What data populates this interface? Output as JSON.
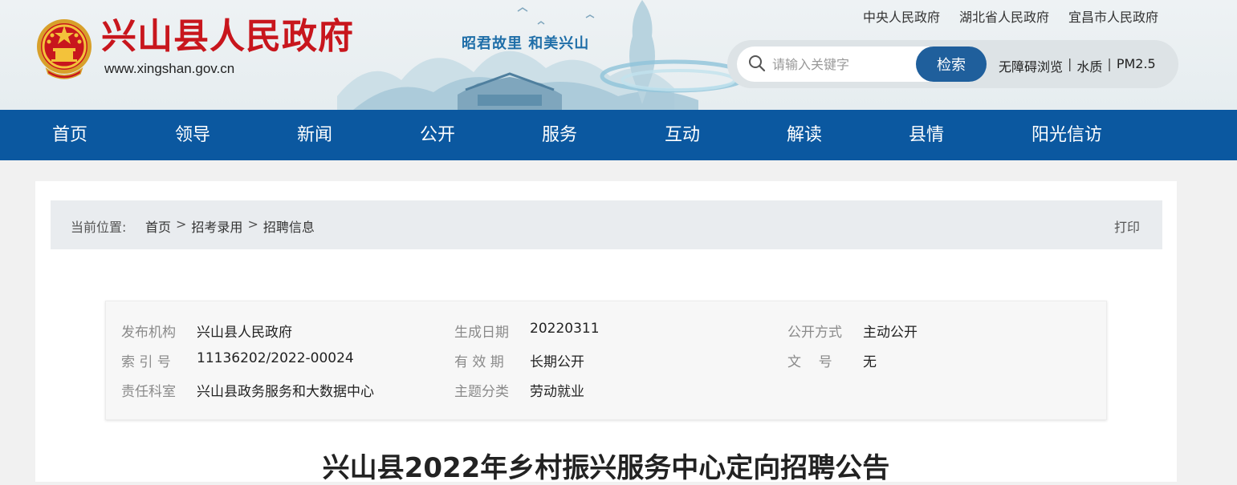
{
  "header": {
    "site_title": "兴山县人民政府",
    "site_url": "www.xingshan.gov.cn",
    "slogan": "昭君故里  和美兴山",
    "top_links": [
      "中央人民政府",
      "湖北省人民政府",
      "宜昌市人民政府"
    ],
    "search": {
      "placeholder": "请输入关键字",
      "button": "检索"
    },
    "tools": [
      "无障碍浏览",
      "水质",
      "PM2.5"
    ],
    "brand_color": "#c8161d",
    "accent_color": "#0b58a0"
  },
  "nav": {
    "items": [
      "首页",
      "领导",
      "新闻",
      "公开",
      "服务",
      "互动",
      "解读",
      "县情",
      "阳光信访"
    ]
  },
  "breadcrumb": {
    "label": "当前位置:",
    "items": [
      "首页",
      "招考录用",
      "招聘信息"
    ],
    "print": "打印"
  },
  "meta": {
    "publisher": {
      "label": "发布机构",
      "value": "兴山县人民政府"
    },
    "date": {
      "label": "生成日期",
      "value": "20220311"
    },
    "disclosure": {
      "label": "公开方式",
      "value": "主动公开"
    },
    "index": {
      "label": "索 引 号",
      "value": "11136202/2022-00024"
    },
    "validity": {
      "label": "有 效 期",
      "value": "长期公开"
    },
    "doc_no": {
      "label": "文    号",
      "value": "无"
    },
    "department": {
      "label": "责任科室",
      "value": "兴山县政务服务和大数据中心"
    },
    "topic": {
      "label": "主题分类",
      "value": "劳动就业"
    }
  },
  "document": {
    "title": "兴山县2022年乡村振兴服务中心定向招聘公告"
  }
}
